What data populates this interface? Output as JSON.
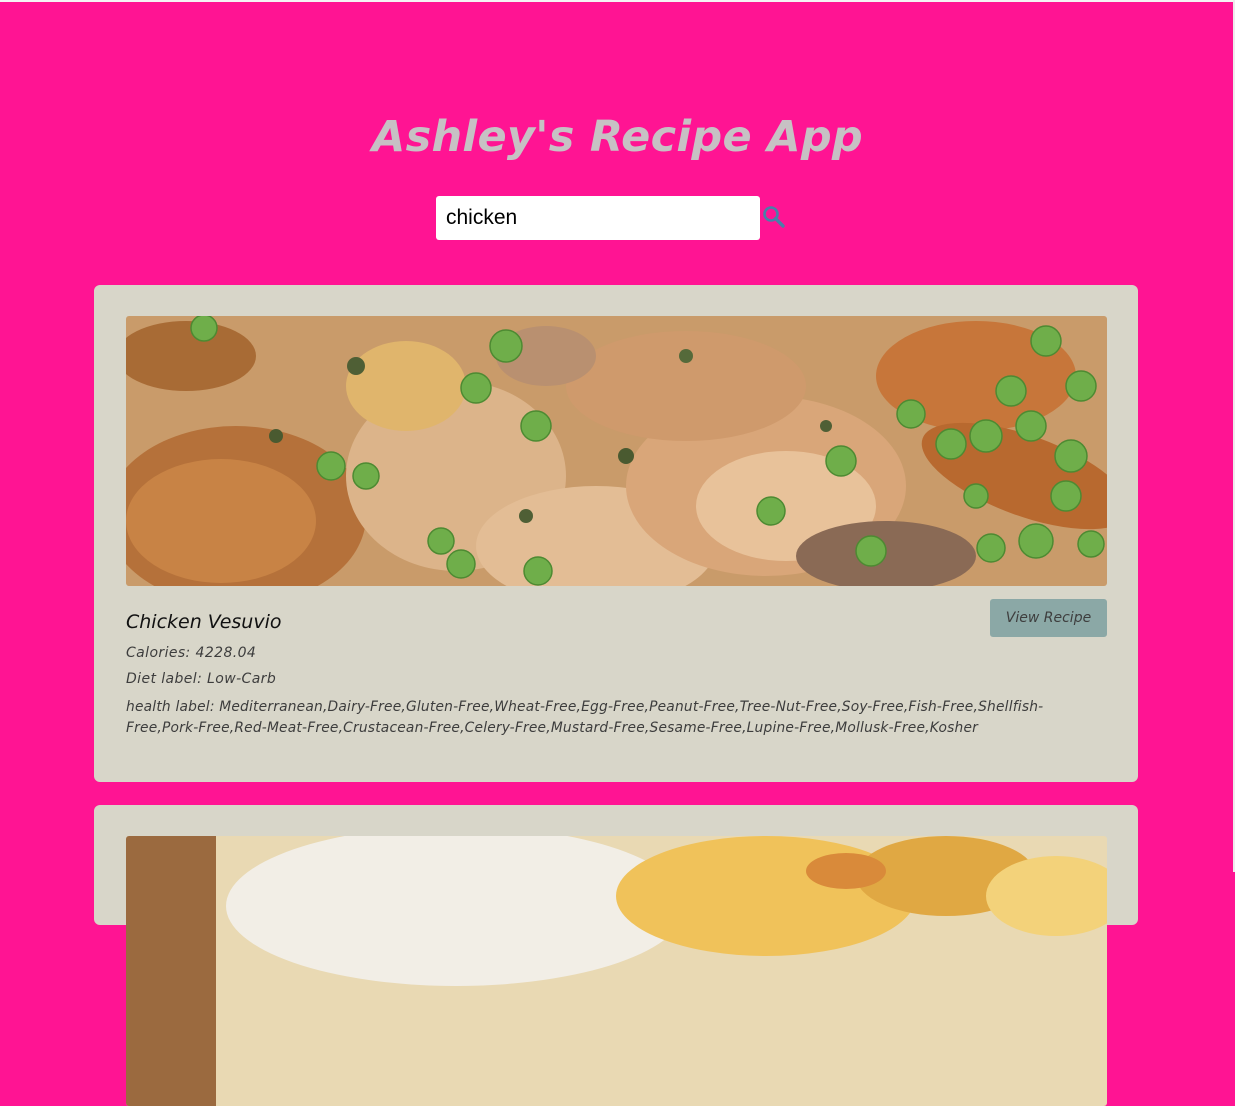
{
  "app": {
    "title": "Ashley's Recipe App"
  },
  "search": {
    "value": "chicken",
    "icon": "search-icon",
    "icon_color": "#4a7fa8"
  },
  "colors": {
    "background": "#ff1493",
    "card": "#d8d6c9",
    "button": "#8ba8a6",
    "title": "#c7c1c4"
  },
  "recipes": [
    {
      "title": "Chicken Vesuvio",
      "calories": "Calories: 4228.04",
      "diet": "Diet label: Low-Carb",
      "health": "health label: Mediterranean,Dairy-Free,Gluten-Free,Wheat-Free,Egg-Free,Peanut-Free,Tree-Nut-Free,Soy-Free,Fish-Free,Shellfish-Free,Pork-Free,Red-Meat-Free,Crustacean-Free,Celery-Free,Mustard-Free,Sesame-Free,Lupine-Free,Mollusk-Free,Kosher",
      "button_label": "View Recipe"
    }
  ]
}
